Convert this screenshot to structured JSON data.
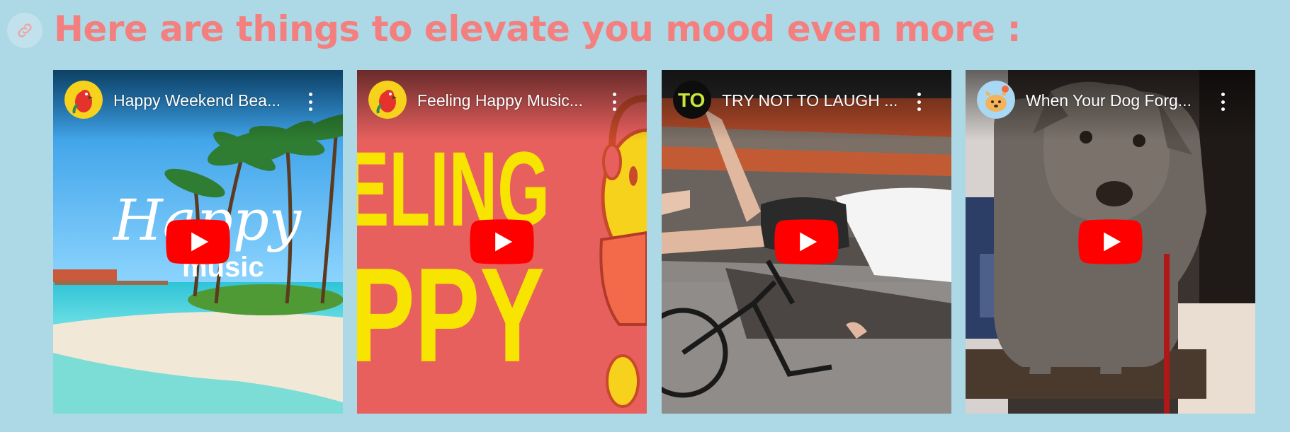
{
  "heading": "Here are things to elevate you mood even more :",
  "colors": {
    "background": "#add8e6",
    "heading": "#f47f7f",
    "play_button": "#ff0000"
  },
  "videos": [
    {
      "title": "Happy Weekend Bea...",
      "thumbnail_text_1": "Happy",
      "thumbnail_text_2": "music",
      "channel_avatar": "parrot-avatar"
    },
    {
      "title": "Feeling Happy Music...",
      "thumbnail_text_1": "ELING",
      "thumbnail_text_2": "PPY",
      "channel_avatar": "parrot-avatar"
    },
    {
      "title": "TRY NOT TO LAUGH ...",
      "channel_avatar_text": "TO",
      "channel_avatar": "tnt-avatar"
    },
    {
      "title": "When Your Dog Forg...",
      "channel_avatar": "dog-avatar"
    }
  ],
  "icons": [
    "link-icon",
    "more-vert-icon",
    "youtube-play-icon"
  ]
}
